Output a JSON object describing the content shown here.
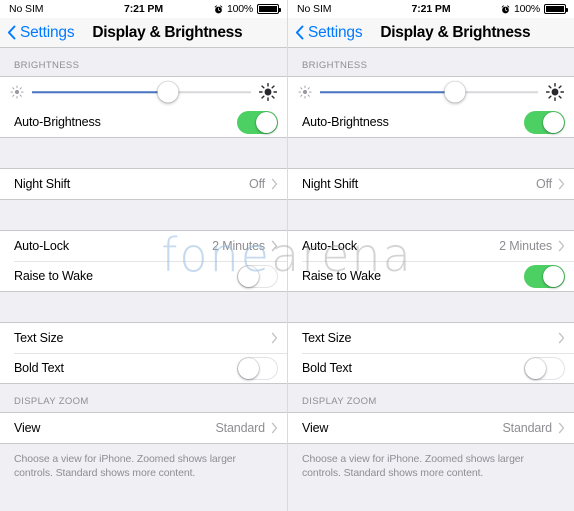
{
  "meta": {
    "watermark_part1": "fone",
    "watermark_part2": "arena",
    "accent_blue": "#007aff",
    "toggle_green": "#4cd063",
    "slider_fill": "#4a76c4",
    "separator": "#c8c7cc"
  },
  "status_bar": {
    "carrier": "No SIM",
    "time": "7:21 PM",
    "battery_percent": "100%",
    "alarm_icon": "alarm-clock-icon",
    "battery_icon": "battery-full-icon"
  },
  "nav": {
    "back_label": "Settings",
    "back_icon": "chevron-left-icon",
    "title": "Display & Brightness"
  },
  "sections": {
    "brightness": {
      "header": "BRIGHTNESS",
      "slider": {
        "min_icon": "brightness-low-icon",
        "max_icon": "brightness-high-icon",
        "value_percent": 62
      },
      "auto_brightness": {
        "label": "Auto-Brightness",
        "toggle": "on"
      }
    },
    "night_shift": {
      "label": "Night Shift",
      "value": "Off",
      "chevron": "chevron-right-icon"
    },
    "lock": {
      "auto_lock": {
        "label": "Auto-Lock",
        "value": "2 Minutes",
        "chevron": "chevron-right-icon"
      },
      "raise_to_wake": {
        "label": "Raise to Wake",
        "toggle_left": "off",
        "toggle_right": "on"
      }
    },
    "text": {
      "text_size": {
        "label": "Text Size",
        "chevron": "chevron-right-icon"
      },
      "bold_text": {
        "label": "Bold Text",
        "toggle": "off"
      }
    },
    "display_zoom": {
      "header": "DISPLAY ZOOM",
      "view": {
        "label": "View",
        "value": "Standard",
        "chevron": "chevron-right-icon"
      },
      "footer": "Choose a view for iPhone. Zoomed shows larger controls. Standard shows more content."
    }
  }
}
